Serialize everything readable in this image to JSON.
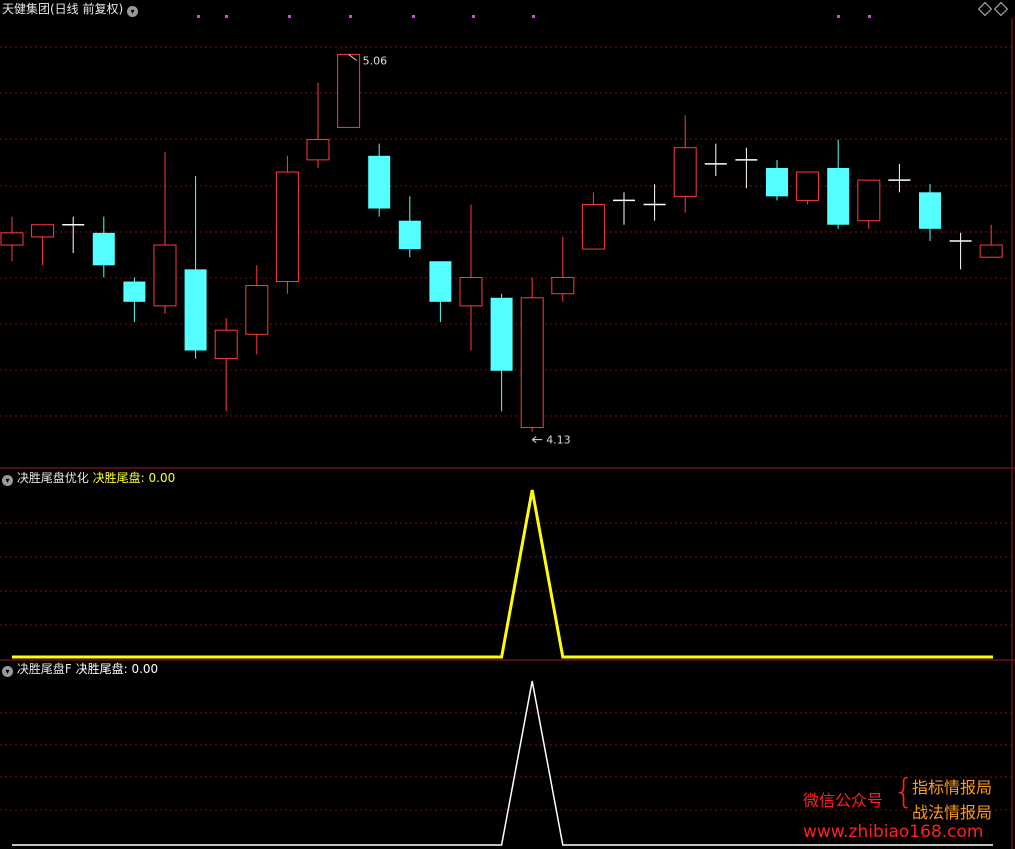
{
  "header": {
    "title": "天健集团(日线 前复权)",
    "dropdown_icon": "chevron-down-icon"
  },
  "panel2": {
    "name": "决胜尾盘优化",
    "series_label": "决胜尾盘:",
    "value": "0.00"
  },
  "panel3": {
    "name": "决胜尾盘F",
    "series_label": "决胜尾盘:",
    "value": "0.00"
  },
  "annotations": {
    "high": "5.06",
    "low": "4.13"
  },
  "watermark": {
    "left": "微信公众号",
    "right_top": "指标情报局",
    "right_bottom": "战法情报局",
    "url": "www.zhibiao168.com"
  },
  "colors": {
    "up": "#ff3b3b",
    "down": "#54ffff",
    "doji": "#ffffff",
    "line_yellow": "#ffff00",
    "line_white": "#ffffff",
    "grid": "#7a1010"
  },
  "chart_data": [
    {
      "type": "candlestick",
      "ylim": [
        4.06,
        5.13
      ],
      "high_label": 5.06,
      "low_label": 4.13,
      "candles": [
        {
          "o": 4.59,
          "h": 4.66,
          "l": 4.55,
          "c": 4.62
        },
        {
          "o": 4.61,
          "h": 4.64,
          "l": 4.54,
          "c": 4.64
        },
        {
          "o": 4.64,
          "h": 4.66,
          "l": 4.57,
          "c": 4.63
        },
        {
          "o": 4.62,
          "h": 4.66,
          "l": 4.51,
          "c": 4.54
        },
        {
          "o": 4.5,
          "h": 4.51,
          "l": 4.4,
          "c": 4.45
        },
        {
          "o": 4.44,
          "h": 4.82,
          "l": 4.42,
          "c": 4.59
        },
        {
          "o": 4.53,
          "h": 4.76,
          "l": 4.31,
          "c": 4.33
        },
        {
          "o": 4.31,
          "h": 4.41,
          "l": 4.18,
          "c": 4.38
        },
        {
          "o": 4.37,
          "h": 4.54,
          "l": 4.32,
          "c": 4.49
        },
        {
          "o": 4.5,
          "h": 4.81,
          "l": 4.47,
          "c": 4.77
        },
        {
          "o": 4.8,
          "h": 4.99,
          "l": 4.78,
          "c": 4.85
        },
        {
          "o": 4.88,
          "h": 5.06,
          "l": 4.88,
          "c": 5.06
        },
        {
          "o": 4.81,
          "h": 4.84,
          "l": 4.66,
          "c": 4.68
        },
        {
          "o": 4.65,
          "h": 4.71,
          "l": 4.56,
          "c": 4.58
        },
        {
          "o": 4.55,
          "h": 4.55,
          "l": 4.4,
          "c": 4.45
        },
        {
          "o": 4.44,
          "h": 4.69,
          "l": 4.33,
          "c": 4.51
        },
        {
          "o": 4.46,
          "h": 4.47,
          "l": 4.18,
          "c": 4.28
        },
        {
          "o": 4.14,
          "h": 4.51,
          "l": 4.13,
          "c": 4.46
        },
        {
          "o": 4.47,
          "h": 4.61,
          "l": 4.45,
          "c": 4.51
        },
        {
          "o": 4.58,
          "h": 4.72,
          "l": 4.58,
          "c": 4.69
        },
        {
          "o": 4.7,
          "h": 4.72,
          "l": 4.64,
          "c": 4.69
        },
        {
          "o": 4.69,
          "h": 4.74,
          "l": 4.65,
          "c": 4.69
        },
        {
          "o": 4.71,
          "h": 4.91,
          "l": 4.67,
          "c": 4.83
        },
        {
          "o": 4.79,
          "h": 4.84,
          "l": 4.76,
          "c": 4.78
        },
        {
          "o": 4.8,
          "h": 4.83,
          "l": 4.73,
          "c": 4.8
        },
        {
          "o": 4.78,
          "h": 4.8,
          "l": 4.7,
          "c": 4.71
        },
        {
          "o": 4.7,
          "h": 4.77,
          "l": 4.69,
          "c": 4.77
        },
        {
          "o": 4.78,
          "h": 4.85,
          "l": 4.63,
          "c": 4.64
        },
        {
          "o": 4.65,
          "h": 4.75,
          "l": 4.63,
          "c": 4.75
        },
        {
          "o": 4.75,
          "h": 4.79,
          "l": 4.72,
          "c": 4.74
        },
        {
          "o": 4.72,
          "h": 4.74,
          "l": 4.6,
          "c": 4.63
        },
        {
          "o": 4.6,
          "h": 4.62,
          "l": 4.53,
          "c": 4.6
        },
        {
          "o": 4.56,
          "h": 4.64,
          "l": 4.56,
          "c": 4.59
        }
      ]
    },
    {
      "type": "line",
      "series": [
        {
          "name": "决胜尾盘",
          "color": "#ffff00",
          "values": [
            0,
            0,
            0,
            0,
            0,
            0,
            0,
            0,
            0,
            0,
            0,
            0,
            0,
            0,
            0,
            0,
            0,
            1,
            0,
            0,
            0,
            0,
            0,
            0,
            0,
            0,
            0,
            0,
            0,
            0,
            0,
            0,
            0
          ]
        }
      ],
      "ylim": [
        0,
        1
      ]
    },
    {
      "type": "line",
      "series": [
        {
          "name": "决胜尾盘",
          "color": "#ffffff",
          "values": [
            0,
            0,
            0,
            0,
            0,
            0,
            0,
            0,
            0,
            0,
            0,
            0,
            0,
            0,
            0,
            0,
            0,
            1,
            0,
            0,
            0,
            0,
            0,
            0,
            0,
            0,
            0,
            0,
            0,
            0,
            0,
            0,
            0
          ]
        }
      ],
      "ylim": [
        0,
        1
      ]
    }
  ]
}
